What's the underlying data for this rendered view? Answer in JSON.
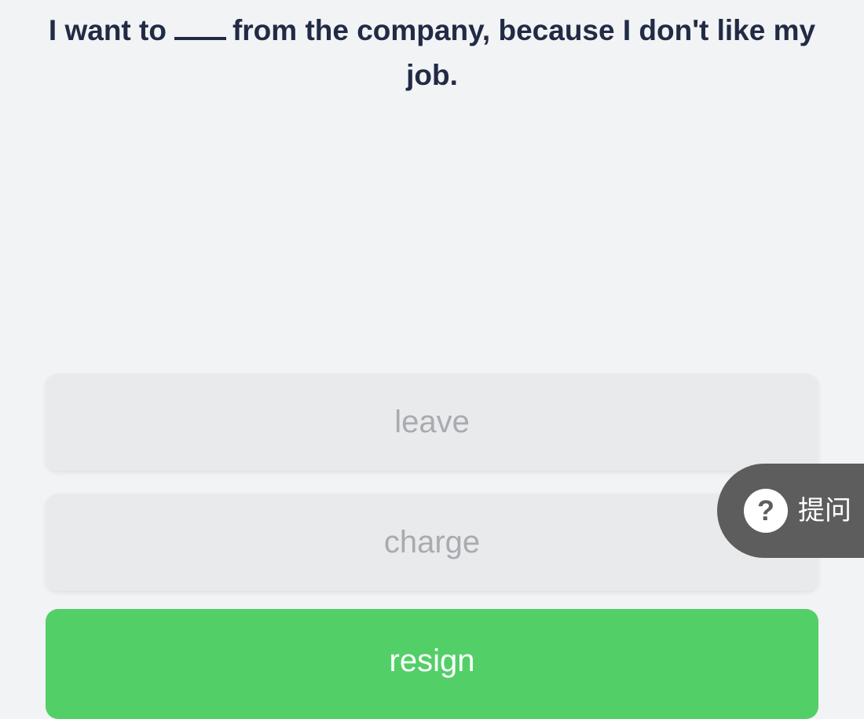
{
  "question": {
    "before_blank": "I want to",
    "after_blank": "from the company, because I don't like my job."
  },
  "options": [
    {
      "label": "leave",
      "state": "neutral"
    },
    {
      "label": "charge",
      "state": "neutral"
    },
    {
      "label": "resign",
      "state": "correct"
    }
  ],
  "ask_button": {
    "icon": "question-circle-icon",
    "label": "提问"
  },
  "colors": {
    "background": "#f2f3f5",
    "text_dark": "#222b45",
    "option_neutral_bg": "#e9eaec",
    "option_neutral_text": "#a9abb0",
    "option_correct_bg": "#53cf68",
    "ask_pill_bg": "#5d5d5d"
  }
}
